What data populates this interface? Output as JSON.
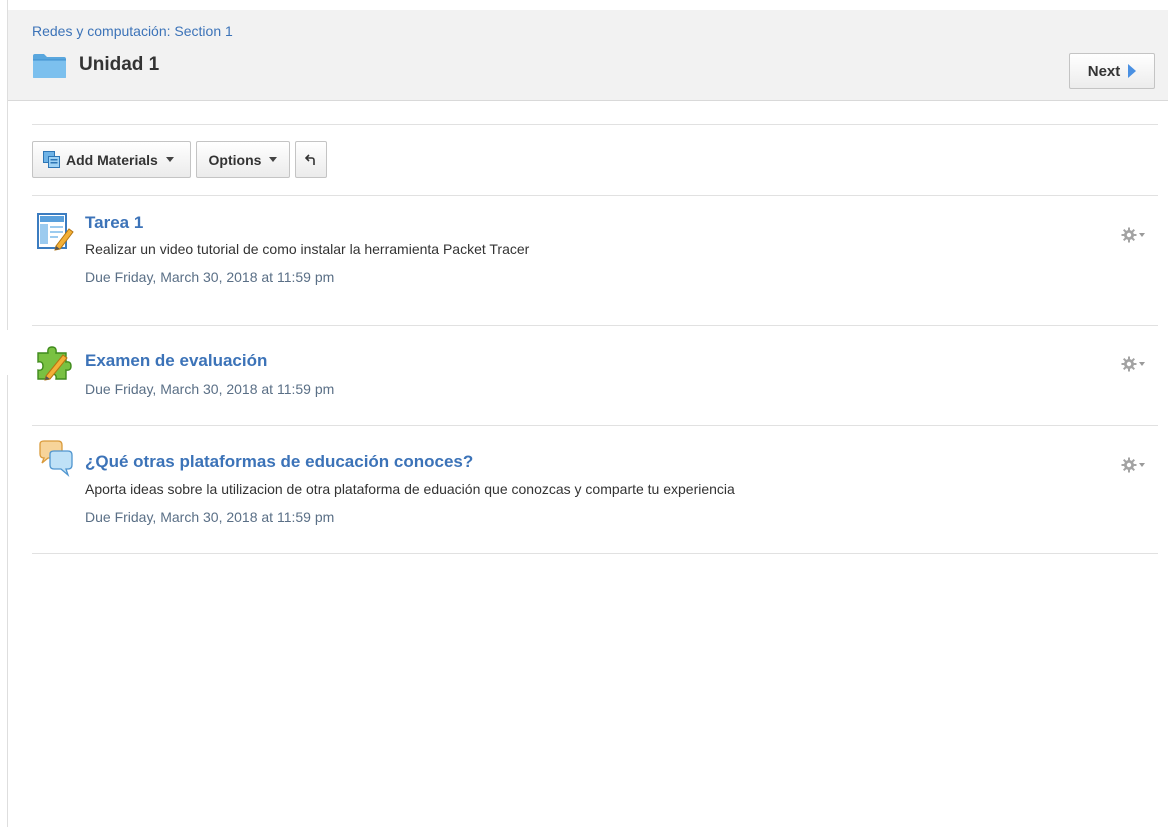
{
  "header": {
    "breadcrumb": "Redes y computación: Section 1",
    "title": "Unidad 1",
    "folder_icon": "folder-icon",
    "next_label": "Next",
    "next_icon": "play-arrow-icon"
  },
  "toolbar": {
    "add_materials_label": "Add Materials",
    "add_materials_icon": "add-materials-icon",
    "options_label": "Options",
    "undo_icon": "undo-arrow-icon"
  },
  "items": [
    {
      "type": "assignment",
      "icon": "assignment-icon",
      "title": "Tarea 1",
      "description": "Realizar un video tutorial de como instalar la herramienta Packet Tracer",
      "due": "Due Friday, March 30, 2018 at 11:59 pm"
    },
    {
      "type": "assessment",
      "icon": "assessment-puzzle-icon",
      "title": "Examen de evaluación",
      "description": "",
      "due": "Due Friday, March 30, 2018 at 11:59 pm"
    },
    {
      "type": "discussion",
      "icon": "discussion-bubbles-icon",
      "title": "¿Qué otras plataformas de educación conoces?",
      "description": "Aporta ideas sobre la utilizacion de otra plataforma de eduación que conozcas y comparte tu experiencia",
      "due": "Due Friday, March 30, 2018 at 11:59 pm"
    }
  ],
  "colors": {
    "link": "#3c73b8",
    "due_text": "#5a6f86",
    "header_bg": "#f2f2f2",
    "next_arrow": "#4a90e2"
  }
}
